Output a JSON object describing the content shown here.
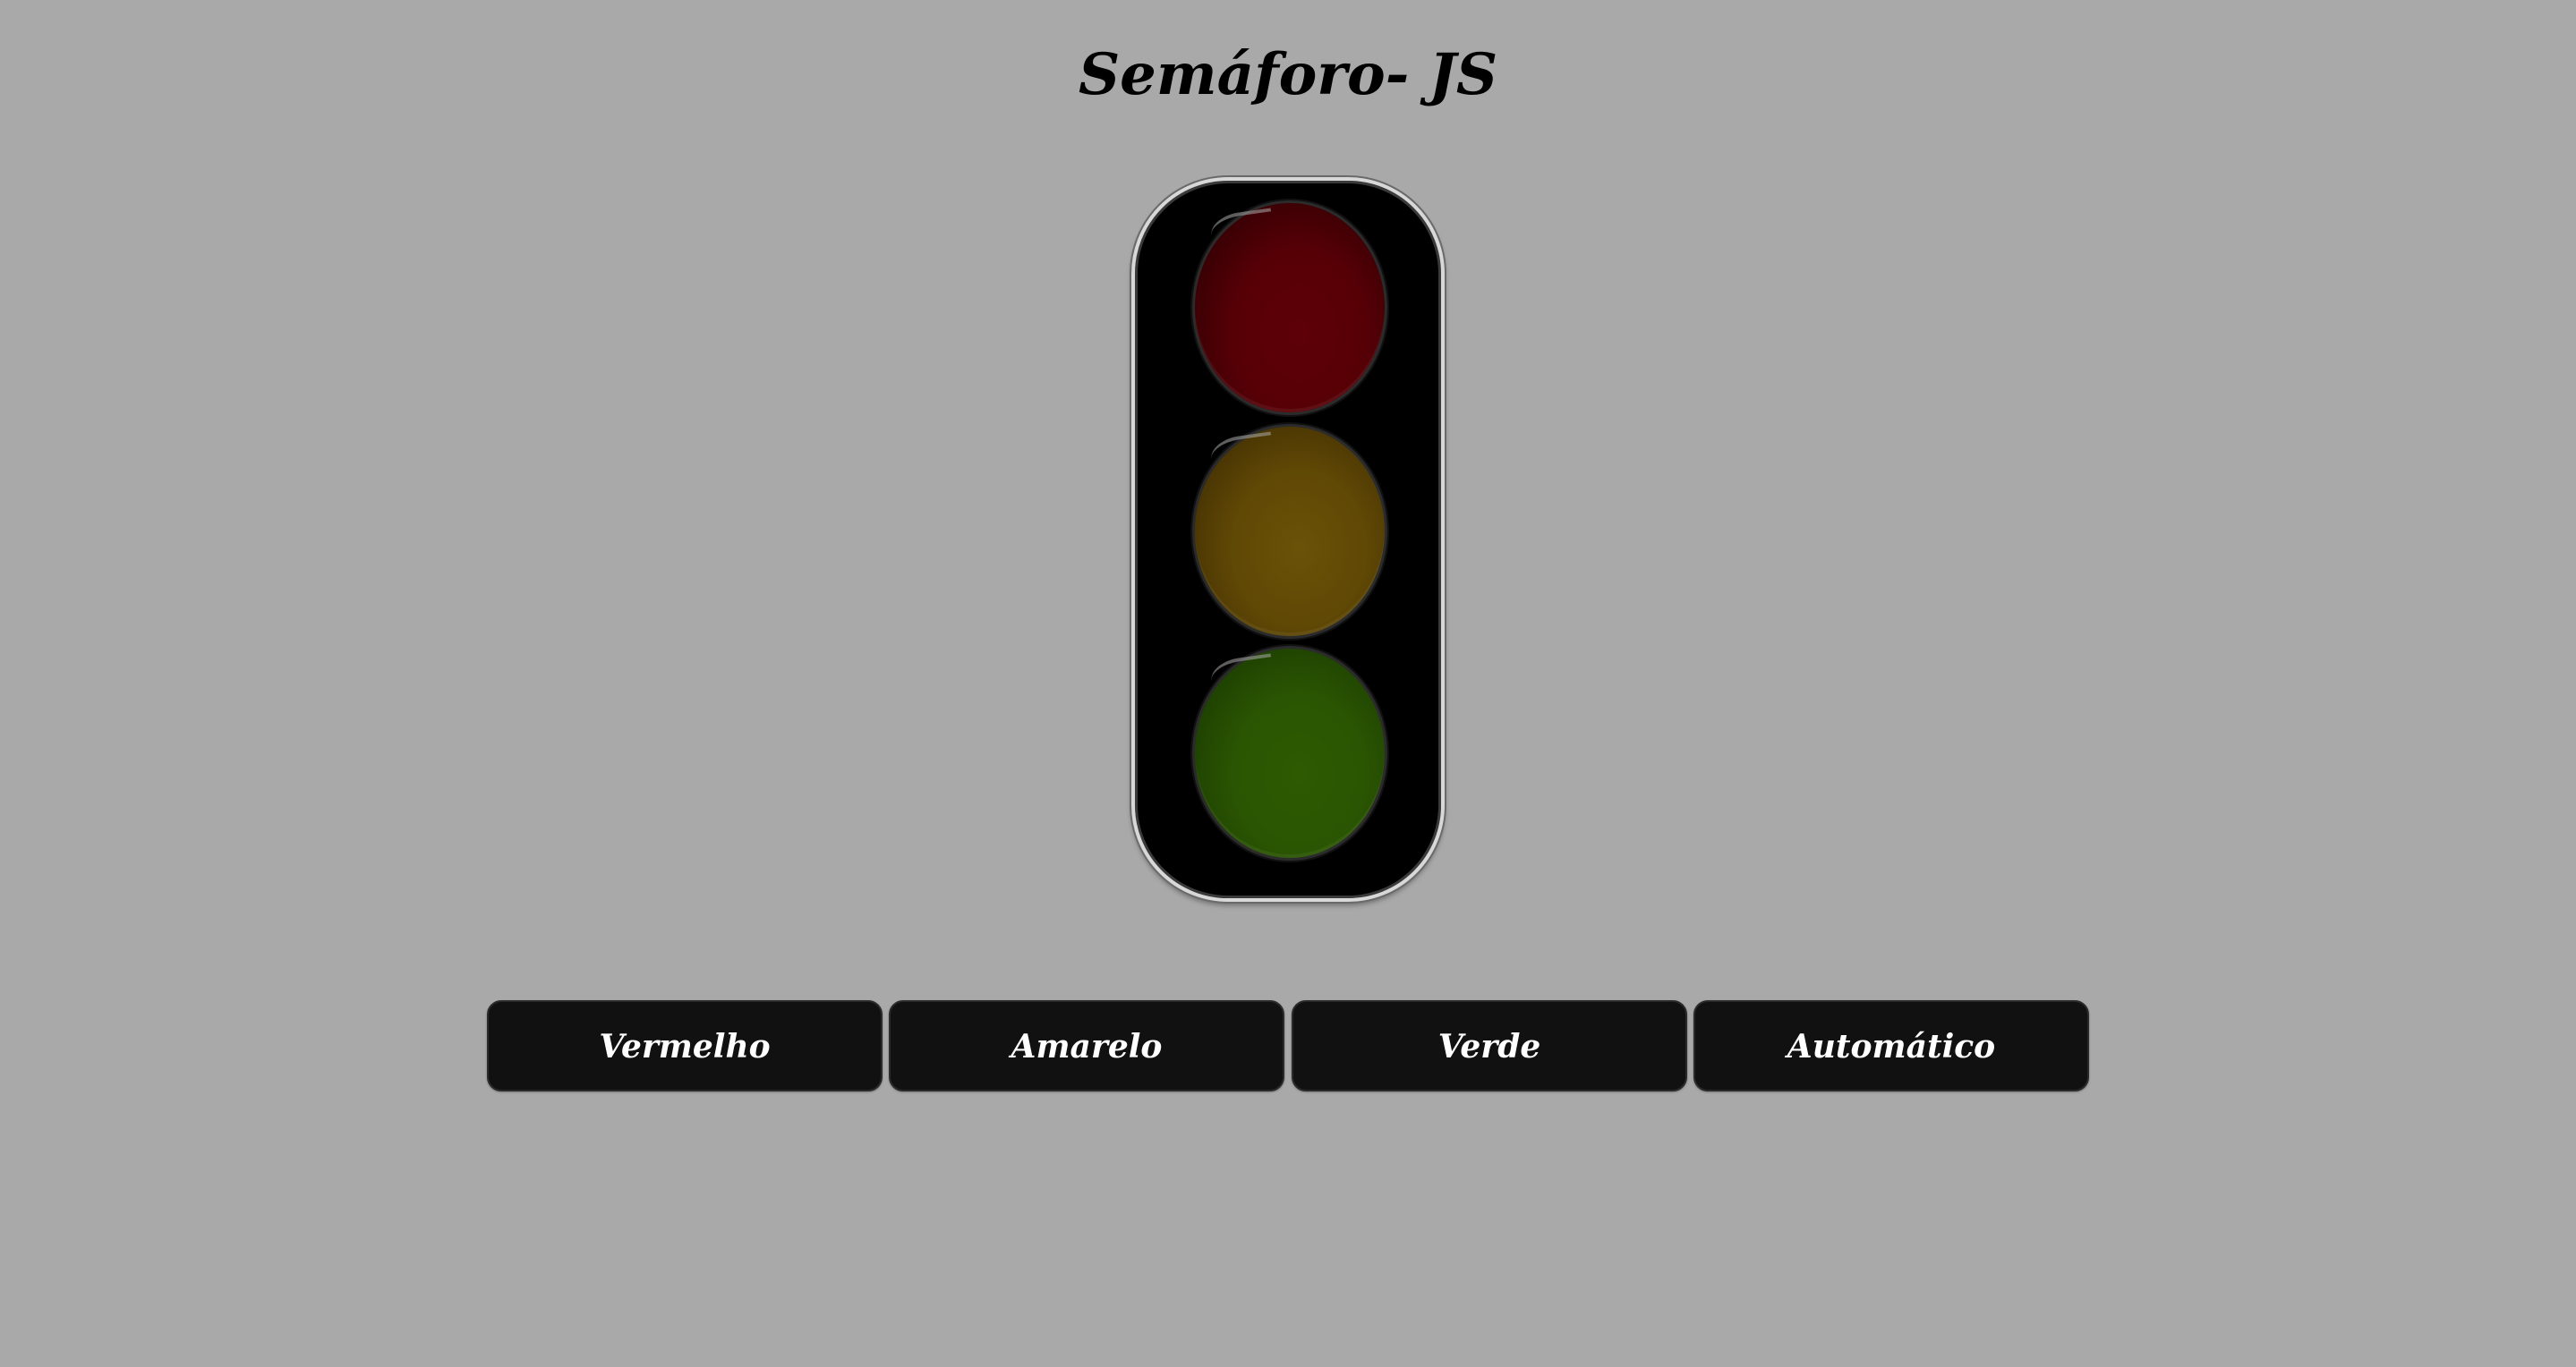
{
  "title": "Semáforo- JS",
  "traffic_light": {
    "lamps": [
      {
        "name": "red",
        "color": "#5a0006",
        "state": "off"
      },
      {
        "name": "yellow",
        "color": "#644c06",
        "state": "off"
      },
      {
        "name": "green",
        "color": "#2b5702",
        "state": "off"
      }
    ]
  },
  "buttons": [
    {
      "label": "Vermelho"
    },
    {
      "label": "Amarelo"
    },
    {
      "label": "Verde"
    },
    {
      "label": "Automático"
    }
  ],
  "colors": {
    "background": "#a9a9a9",
    "button_bg": "#111111",
    "button_text": "#ffffff",
    "title_text": "#000000"
  }
}
